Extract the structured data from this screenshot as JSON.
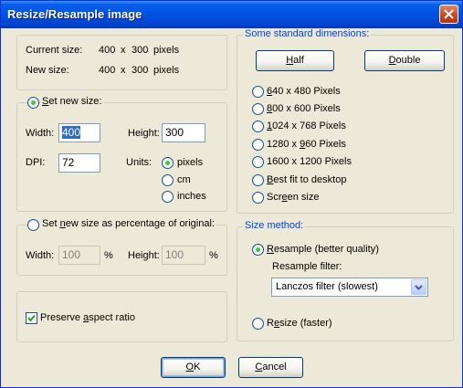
{
  "window": {
    "title": "Resize/Resample image"
  },
  "info": {
    "current_label": "Current size:",
    "current_w": "400",
    "current_x": "x",
    "current_h": "300",
    "current_unit": "pixels",
    "new_label": "New size:",
    "new_w": "400",
    "new_x": "x",
    "new_h": "300",
    "new_unit": "pixels"
  },
  "set_new_size": {
    "label": "Set new size:",
    "width_label": "Width:",
    "width_value": "400",
    "height_label": "Height:",
    "height_value": "300",
    "dpi_label": "DPI:",
    "dpi_value": "72",
    "units_label": "Units:",
    "units": [
      "pixels",
      "cm",
      "inches"
    ],
    "selected_unit": "pixels"
  },
  "percentage": {
    "label": "Set new size as percentage of original:",
    "width_label": "Width:",
    "width_value": "100",
    "width_unit": "%",
    "height_label": "Height:",
    "height_value": "100",
    "height_unit": "%"
  },
  "preserve_aspect": {
    "label": "Preserve aspect ratio",
    "checked": true
  },
  "standard": {
    "legend": "Some standard dimensions:",
    "half_label": "Half",
    "double_label": "Double",
    "options": [
      "640 x 480 Pixels",
      "800 x 600 Pixels",
      "1024 x 768 Pixels",
      "1280 x 960 Pixels",
      "1600 x 1200 Pixels",
      "Best fit to desktop",
      "Screen size"
    ]
  },
  "size_method": {
    "legend": "Size method:",
    "resample_label": "Resample (better quality)",
    "filter_label": "Resample filter:",
    "filter_value": "Lanczos filter (slowest)",
    "resize_label": "Resize (faster)",
    "selected": "resample"
  },
  "footer": {
    "ok_label": "OK",
    "cancel_label": "Cancel"
  },
  "colors": {
    "titlebar": "#0055E5",
    "face": "#ECE9D8",
    "legend_text": "#0046D5"
  },
  "icons": {
    "close": "close-icon",
    "dropdown": "chevron-down-icon",
    "check": "checkmark-icon"
  }
}
